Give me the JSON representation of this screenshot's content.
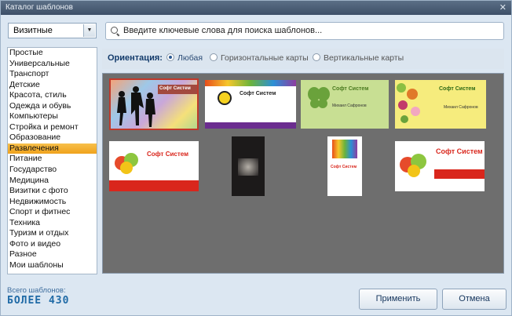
{
  "window": {
    "title": "Каталог шаблонов",
    "close_glyph": "✕"
  },
  "category_select": {
    "value": "Визитные",
    "arrow": "▼"
  },
  "search": {
    "placeholder": "Введите ключевые слова для поиска шаблонов..."
  },
  "categories": [
    "Простые",
    "Универсальные",
    "Транспорт",
    "Детские",
    "Красота, стиль",
    "Одежда и обувь",
    "Компьютеры",
    "Стройка и ремонт",
    "Образование",
    "Развлечения",
    "Питание",
    "Государство",
    "Медицина",
    "Визитки с фото",
    "Недвижимость",
    "Спорт и фитнес",
    "Техника",
    "Туризм и отдых",
    "Фото и видео",
    "Разное",
    "Мои шаблоны"
  ],
  "selected_category_index": 9,
  "orientation": {
    "label": "Ориентация:",
    "options": [
      "Любая",
      "Горизонтальные карты",
      "Вертикальные карты"
    ],
    "selected_index": 0
  },
  "templates": {
    "brand": "Софт Систем",
    "name": "Михаил Сафронов",
    "colors": {
      "gallery_bg": "#6e6e6e",
      "selection": "#c0392b",
      "accent_red": "#d9261c",
      "accent_green": "#b7d97a"
    }
  },
  "footer": {
    "count_label": "Всего шаблонов:",
    "count_value": "БОЛЕЕ 430"
  },
  "buttons": {
    "apply": "Применить",
    "cancel": "Отмена"
  }
}
